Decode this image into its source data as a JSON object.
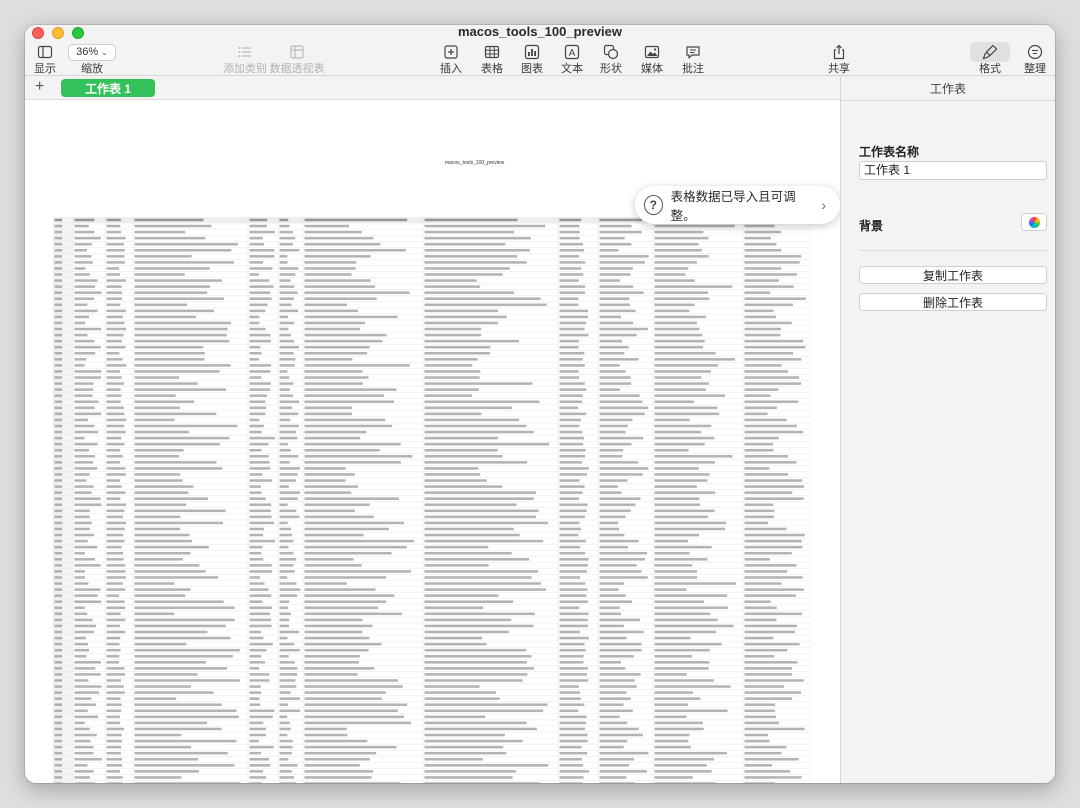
{
  "window": {
    "title": "macos_tools_100_preview"
  },
  "toolbar": {
    "view_label": "显示",
    "zoom_value": "36%",
    "zoom_label": "缩放",
    "add_category_label": "添加类别",
    "pivot_label": "数据透视表",
    "insert_label": "插入",
    "table_label": "表格",
    "chart_label": "图表",
    "text_label": "文本",
    "shape_label": "形状",
    "media_label": "媒体",
    "comment_label": "批注",
    "share_label": "共享",
    "format_label": "格式",
    "organize_label": "整理"
  },
  "tabs": {
    "add": "+",
    "sheets": [
      "工作表 1"
    ]
  },
  "canvas": {
    "sheet_title": "macos_tools_100_preview",
    "toast_text": "表格数据已导入且可调整。",
    "toast_icon": "?",
    "toast_chevron": "›"
  },
  "inspector": {
    "header": "工作表",
    "name_label": "工作表名称",
    "name_value": "工作表 1",
    "background_label": "背景",
    "duplicate_label": "复制工作表",
    "delete_label": "删除工作表"
  }
}
